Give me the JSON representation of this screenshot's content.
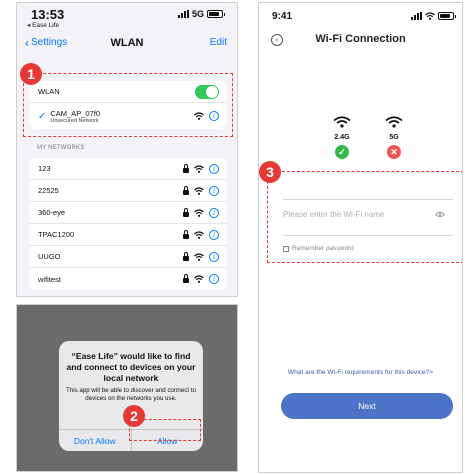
{
  "wlan_screen": {
    "status": {
      "time": "13:53",
      "back_app": "◂ Ease Life",
      "network": "5G"
    },
    "nav": {
      "back_label": "Settings",
      "title": "WLAN",
      "edit_label": "Edit"
    },
    "wlan_toggle": {
      "label": "WLAN",
      "on": true
    },
    "connected": {
      "ssid": "CAM_AP_07f0",
      "security": "Unsecured Network"
    },
    "section_header": "MY NETWORKS",
    "networks": [
      "123",
      "22525",
      "360-eye",
      "TPAC1200",
      "UUGO",
      "wifitest"
    ]
  },
  "permission_dialog": {
    "title": "“Ease Life” would like to find and connect to devices on your local network",
    "message": "This app will be able to discover and connect to devices on the networks you use.",
    "deny_label": "Don't Allow",
    "allow_label": "Allow"
  },
  "wifi_screen": {
    "status": {
      "time": "9:41"
    },
    "title": "Wi-Fi Connection",
    "bands": [
      {
        "label": "2.4G",
        "status": "supported",
        "icon": "check-icon"
      },
      {
        "label": "5G",
        "status": "unsupported",
        "icon": "cross-icon"
      }
    ],
    "password_placeholder": "Please enter the Wi-Fi name",
    "remember_label": "Remember password",
    "requirements_link": "What are the Wi-Fi requirements for this device?>",
    "next_label": "Next"
  },
  "annotations": {
    "step1": "1",
    "step2": "2",
    "step3": "3"
  },
  "colors": {
    "annotation": "#e53935",
    "ios_blue": "#007aff",
    "toggle_on": "#34c759",
    "next_button": "#4b73c7",
    "ok": "#39b54a",
    "bad": "#f05252"
  }
}
